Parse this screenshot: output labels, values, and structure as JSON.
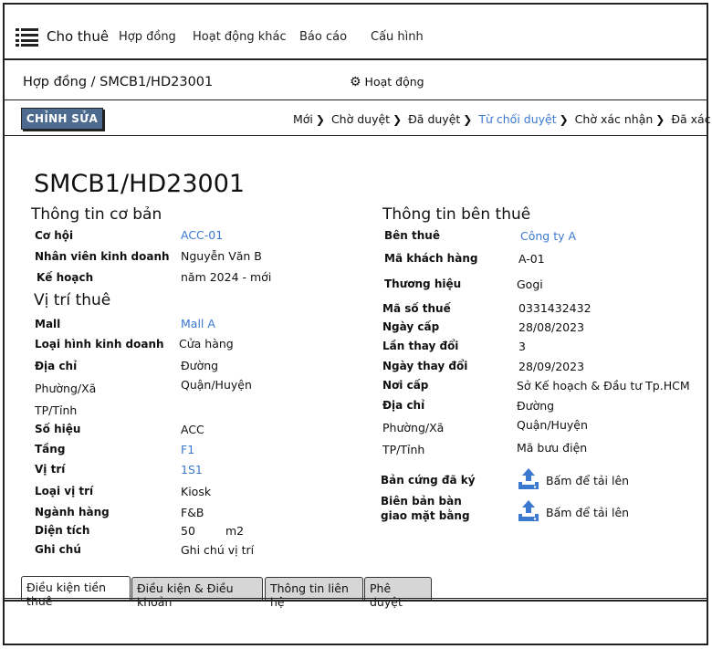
{
  "nav": {
    "app_title": "Cho thuê",
    "menu": [
      "Hợp đồng",
      "Hoạt động khác",
      "Báo cáo",
      "Cấu hình"
    ]
  },
  "header": {
    "breadcrumb": "Hợp đồng / SMCB1/HD23001",
    "activity": "Hoạt động"
  },
  "toolbar": {
    "edit_label": "CHỈNH SỬA",
    "stages": [
      "Mới",
      "Chờ duyệt",
      "Đã duyệt",
      "Từ chối duyệt",
      "Chờ xác nhận",
      "Đã xác nhận"
    ],
    "active_stage": "Từ chối duyệt"
  },
  "record": {
    "title": "SMCB1/HD23001",
    "basic": {
      "heading": "Thông tin cơ bản",
      "opportunity_label": "Cơ hội",
      "opportunity": "ACC-01",
      "sales_label": "Nhân viên kinh doanh",
      "sales": "Nguyễn Văn B",
      "plan_label": "Kế hoạch",
      "plan": "năm 2024 - mới"
    },
    "location": {
      "heading": "Vị trí thuê",
      "mall_label": "Mall",
      "mall": "Mall A",
      "business_type_label": "Loại hình kinh doanh",
      "business_type": "Cửa hàng",
      "address_label": "Địa chỉ",
      "address": "Đường",
      "ward_label": "Phường/Xã",
      "ward": "Quận/Huyện",
      "province_label": "TP/Tỉnh",
      "number_label": "Số hiệu",
      "number": "ACC",
      "floor_label": "Tầng",
      "floor": "F1",
      "position_label": "Vị trí",
      "position": "1S1",
      "position_type_label": "Loại vị trí",
      "position_type": "Kiosk",
      "industry_label": "Ngành hàng",
      "industry": "F&B",
      "area_label": "Diện tích",
      "area": "50",
      "area_unit": "m2",
      "note_label": "Ghi chú",
      "note": "Ghi chú vị trí"
    },
    "tenant": {
      "heading": "Thông tin bên thuê",
      "tenant_label": "Bên thuê",
      "tenant": "Công ty A",
      "customer_code_label": "Mã khách hàng",
      "customer_code": "A-01",
      "brand_label": "Thương hiệu",
      "brand": "Gogi",
      "tax_code_label": "Mã số thuế",
      "tax_code": "0331432432",
      "issue_date_label": "Ngày cấp",
      "issue_date": "28/08/2023",
      "change_count_label": "Lần thay đổi",
      "change_count": "3",
      "change_date_label": "Ngày thay đổi",
      "change_date": "28/09/2023",
      "issuer_label": "Nơi cấp",
      "issuer": "Sở Kế hoạch & Đầu tư Tp.HCM",
      "address_label": "Địa chỉ",
      "address": "Đường",
      "ward_label": "Phường/Xã",
      "ward": "Quận/Huyện",
      "province_label": "TP/Tỉnh",
      "province": "Mã bưu điện",
      "signed_copy_label": "Bản cứng đã ký",
      "handover_label_1": "Biên bản bàn",
      "handover_label_2": "giao mặt bằng",
      "upload_text": "Bấm để tải lên"
    }
  },
  "tabs": [
    "Điều kiện tiền thuê",
    "Điều kiện & Điều khoản",
    "Thông tin liên hệ",
    "Phê duyệt"
  ],
  "colors": {
    "link": "#3b78d0",
    "edit_button": "#4d6a8f"
  }
}
